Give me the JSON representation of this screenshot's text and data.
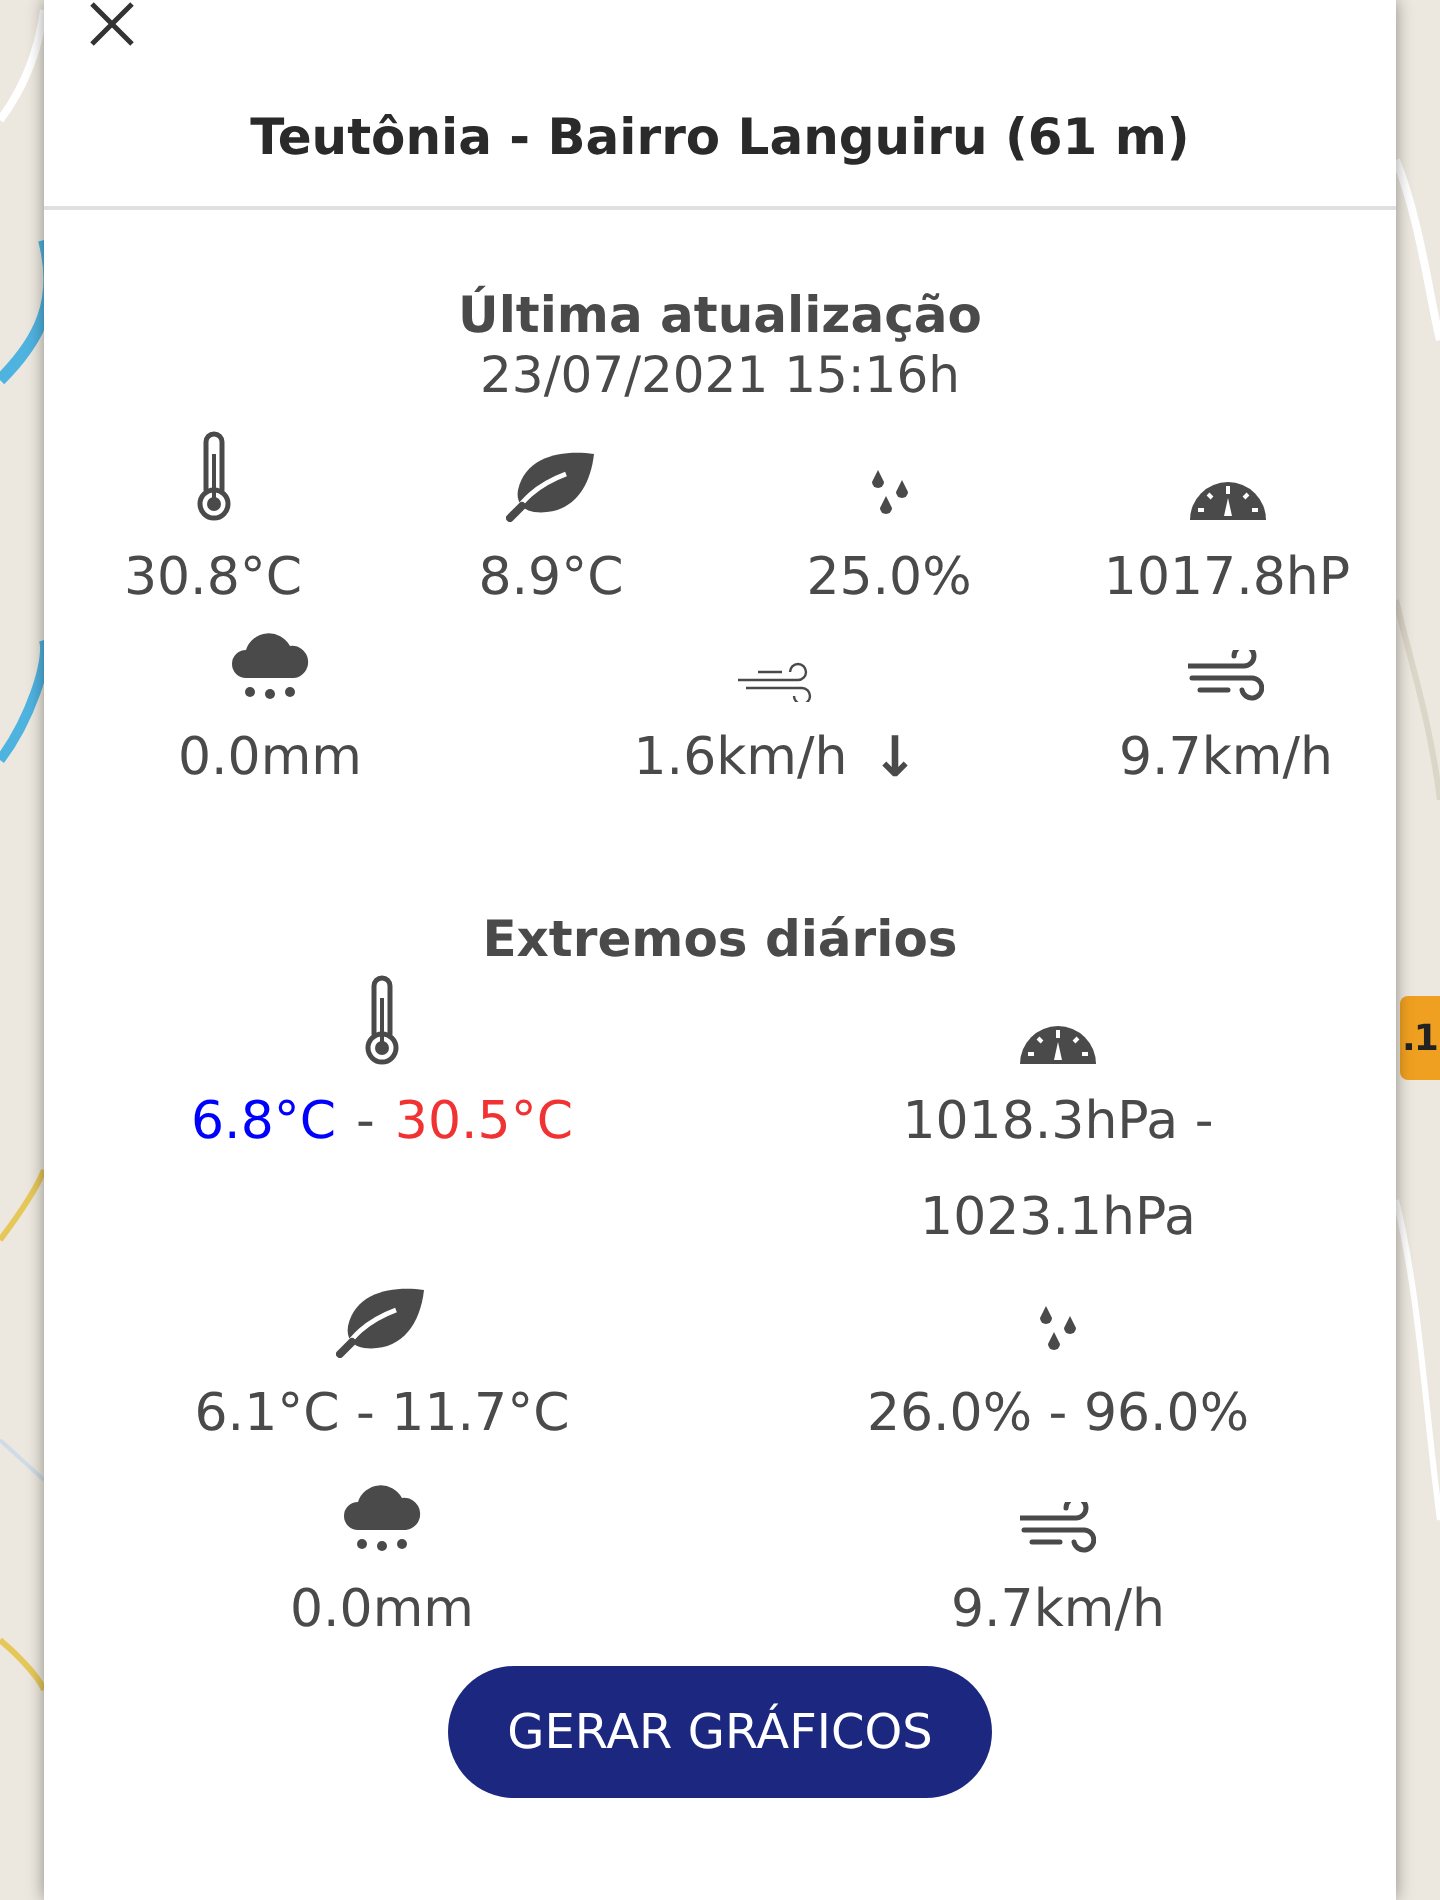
{
  "panel": {
    "title": "Teutônia - Bairro Languiru (61 m)"
  },
  "current": {
    "heading": "Última atualização",
    "timestamp": "23/07/2021 15:16h",
    "row_1": [
      {
        "kind": "temperature",
        "value": "30.8°C"
      },
      {
        "kind": "dewpoint",
        "value": "8.9°C"
      },
      {
        "kind": "humidity",
        "value": "25.0%"
      },
      {
        "kind": "pressure",
        "value": "1017.8hP"
      }
    ],
    "row_2": [
      {
        "kind": "rain",
        "value": "0.0mm"
      },
      {
        "kind": "wind",
        "value": "1.6km/h",
        "direction_arrow": "↓"
      },
      {
        "kind": "gust",
        "value": "9.7km/h"
      }
    ]
  },
  "extremes": {
    "heading": "Extremos diários",
    "items": [
      {
        "kind": "temperature",
        "separator": "-",
        "range": [
          {
            "label": "6.8°C",
            "color": "#0000ff"
          },
          {
            "label": "30.5°C",
            "color": "#f03232"
          }
        ]
      },
      {
        "kind": "pressure",
        "value": "1018.3hPa - 1023.1hPa"
      },
      {
        "kind": "dewpoint",
        "value": "6.1°C - 11.7°C"
      },
      {
        "kind": "humidity",
        "value": "26.0% - 96.0%"
      },
      {
        "kind": "rain",
        "value": "0.0mm"
      },
      {
        "kind": "gust",
        "value": "9.7km/h"
      }
    ]
  },
  "map_marker": {
    "label": ".1"
  },
  "button": {
    "label": "GERAR GRÁFICOS"
  }
}
